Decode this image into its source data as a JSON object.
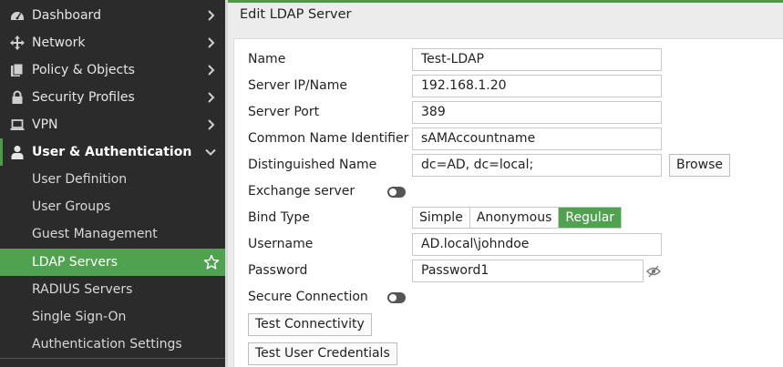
{
  "sidebar": {
    "items": [
      {
        "label": "Dashboard",
        "icon": "dashboard-icon"
      },
      {
        "label": "Network",
        "icon": "network-icon"
      },
      {
        "label": "Policy & Objects",
        "icon": "policy-objects-icon"
      },
      {
        "label": "Security Profiles",
        "icon": "lock-icon"
      },
      {
        "label": "VPN",
        "icon": "laptop-icon"
      },
      {
        "label": "User & Authentication",
        "icon": "user-icon"
      }
    ],
    "sub_items": [
      {
        "label": "User Definition"
      },
      {
        "label": "User Groups"
      },
      {
        "label": "Guest Management"
      },
      {
        "label": "LDAP Servers"
      },
      {
        "label": "RADIUS Servers"
      },
      {
        "label": "Single Sign-On"
      },
      {
        "label": "Authentication Settings"
      }
    ]
  },
  "header": {
    "title": "Edit LDAP Server"
  },
  "form": {
    "name_label": "Name",
    "name_value": "Test-LDAP",
    "server_ip_label": "Server IP/Name",
    "server_ip_value": "192.168.1.20",
    "server_port_label": "Server Port",
    "server_port_value": "389",
    "cn_label": "Common Name Identifier",
    "cn_value": "sAMAccountname",
    "dn_label": "Distinguished Name",
    "dn_value": "dc=AD, dc=local;",
    "browse_label": "Browse",
    "exchange_label": "Exchange server",
    "bind_type_label": "Bind Type",
    "bind_options": [
      "Simple",
      "Anonymous",
      "Regular"
    ],
    "bind_selected": "Regular",
    "username_label": "Username",
    "username_value": "AD.local\\johndoe",
    "password_label": "Password",
    "password_value": "Password1",
    "secure_label": "Secure Connection",
    "test_connectivity_label": "Test Connectivity",
    "test_credentials_label": "Test User Credentials"
  },
  "colors": {
    "accent": "#50a150",
    "sidebar_bg": "#2b2b2b"
  }
}
